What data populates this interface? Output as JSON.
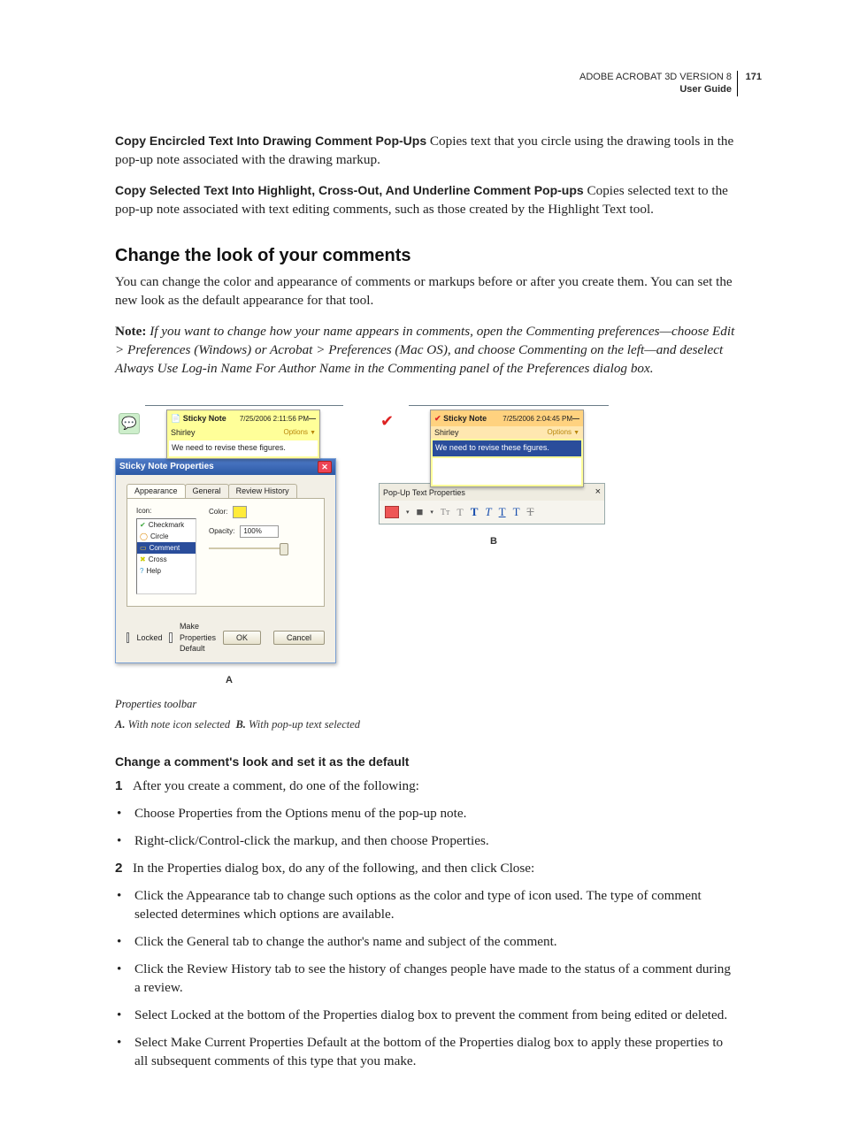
{
  "header": {
    "product": "ADOBE ACROBAT 3D VERSION 8",
    "guide": "User Guide",
    "page": "171"
  },
  "paras": {
    "p1_runin": "Copy Encircled Text Into Drawing Comment Pop-Ups",
    "p1_body": "  Copies text that you circle using the drawing tools in the pop-up note associated with the drawing markup.",
    "p2_runin": "Copy Selected Text Into Highlight, Cross-Out, And Underline Comment Pop-ups",
    "p2_body": "  Copies selected text to the pop-up note associated with text editing comments, such as those created by the Highlight Text tool."
  },
  "h2": "Change the look of your comments",
  "intro": "You can change the color and appearance of comments or markups before or after you create them. You can set the new look as the default appearance for that tool.",
  "note_label": "Note:",
  "note_body": " If you want to change how your name appears in comments, open the Commenting preferences—choose Edit > Preferences (Windows) or Acrobat > Preferences (Mac OS), and choose Commenting on the left—and deselect Always Use Log-in Name For Author Name in the Commenting panel of the Preferences dialog box.",
  "figA": {
    "note": {
      "title": "Sticky Note",
      "date": "7/25/2006 2:11:56 PM",
      "author": "Shirley",
      "options": "Options",
      "body": "We need to revise these figures."
    },
    "dlg": {
      "title": "Sticky Note Properties",
      "tabs": [
        "Appearance",
        "General",
        "Review History"
      ],
      "iconlabel": "Icon:",
      "icons": [
        "Checkmark",
        "Circle",
        "Comment",
        "Cross",
        "Help"
      ],
      "color": "Color:",
      "opacity": "Opacity:",
      "opacity_val": "100%",
      "locked": "Locked",
      "mdefault": "Make Properties Default",
      "ok": "OK",
      "cancel": "Cancel"
    },
    "label": "A"
  },
  "figB": {
    "note": {
      "title": "Sticky Note",
      "date": "7/25/2006 2:04:45 PM",
      "author": "Shirley",
      "options": "Options",
      "body": "We need to revise these figures."
    },
    "toolbar": {
      "title": "Pop-Up Text Properties"
    },
    "label": "B"
  },
  "caption_title": "Properties toolbar",
  "caption_a": "With note icon selected",
  "caption_b": "With pop-up text selected",
  "h3": "Change a comment's look and set it as the default",
  "step1": "After you create a comment, do one of the following:",
  "step1_b1": "Choose Properties from the Options menu of the pop-up note.",
  "step1_b2": "Right-click/Control-click the markup, and then choose Properties.",
  "step2": "In the Properties dialog box, do any of the following, and then click Close:",
  "step2_b1": "Click the Appearance tab to change such options as the color and type of icon used. The type of comment selected determines which options are available.",
  "step2_b2": "Click the General tab to change the author's name and subject of the comment.",
  "step2_b3": "Click the Review History tab to see the history of changes people have made to the status of a comment during a review.",
  "step2_b4": "Select Locked at the bottom of the Properties dialog box to prevent the comment from being edited or deleted.",
  "step2_b5": "Select Make Current Properties Default at the bottom of the Properties dialog box to apply these properties to all subsequent comments of this type that you make."
}
